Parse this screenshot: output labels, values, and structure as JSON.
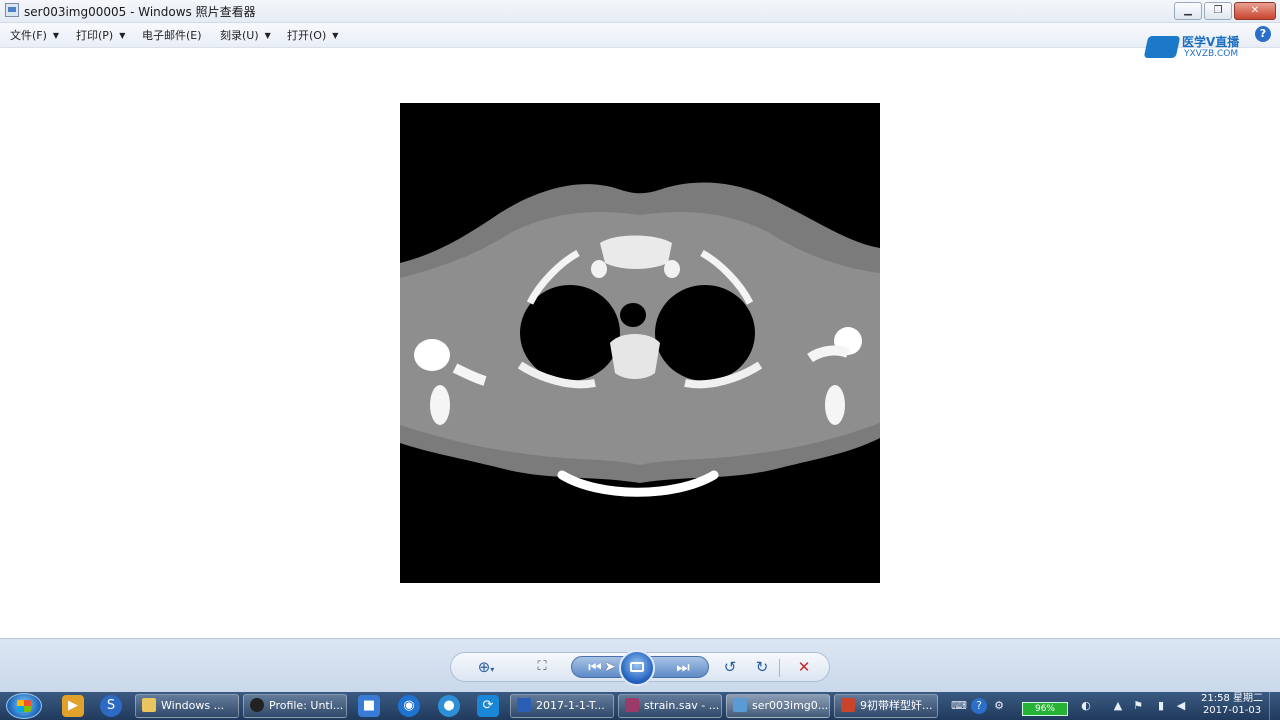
{
  "window": {
    "title": "ser003img00005 - Windows 照片查看器"
  },
  "menu": {
    "items": [
      {
        "label": "文件(F)"
      },
      {
        "label": "打印(P)"
      },
      {
        "label": "电子邮件(E)"
      },
      {
        "label": "刻录(U)"
      },
      {
        "label": "打开(O)"
      }
    ],
    "help_label": "?"
  },
  "logo": {
    "text": "医学V直播",
    "sub": "YXVZB.COM"
  },
  "image": {
    "name": "ser003img00005"
  },
  "controls": {
    "items": [
      "zoom-icon",
      "actual-size-icon",
      "previous-icon",
      "slideshow-icon",
      "next-icon",
      "rotate-ccw-icon",
      "rotate-cw-icon",
      "delete-icon"
    ]
  },
  "taskbar": {
    "items": [
      {
        "label": "Windows ...",
        "icon": "folder-icon",
        "color": "#e8c560"
      },
      {
        "label": "Profile: Unti...",
        "icon": "app-icon",
        "color": "#222222"
      },
      {
        "label": "2017-1-1-T...",
        "icon": "word-icon",
        "color": "#2b5eb5"
      },
      {
        "label": "strain.sav - ...",
        "icon": "spss-icon",
        "color": "#9b3b6a"
      },
      {
        "label": "ser003img0...",
        "icon": "photo-viewer-icon",
        "color": "#5b9bd5"
      },
      {
        "label": "9初带样型奸...",
        "icon": "powerpoint-icon",
        "color": "#c9442c"
      }
    ],
    "battery": "96%",
    "clock_time": "21:58 星期二",
    "clock_date": "2017-01-03"
  }
}
